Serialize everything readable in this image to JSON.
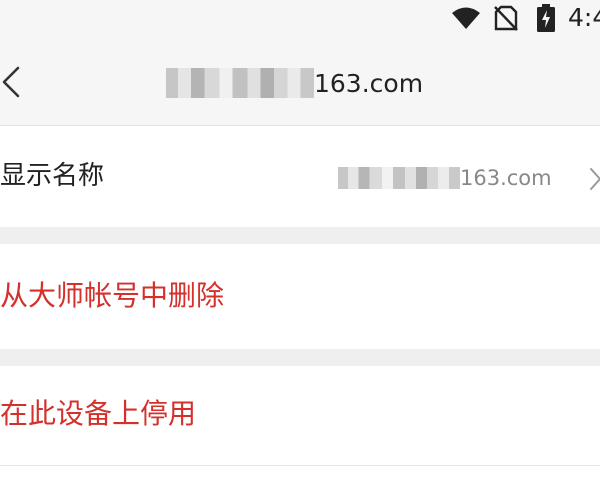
{
  "status_bar": {
    "time": "4:4",
    "icons": [
      "wifi-icon",
      "no-sim-icon",
      "battery-charging-icon"
    ]
  },
  "header": {
    "back_icon": "chevron-left-icon",
    "account_suffix": "163.com",
    "account_prefix_obscured": true
  },
  "display_name_row": {
    "label": "显示名称",
    "value_suffix": "163.com",
    "value_prefix_obscured": true,
    "chevron_icon": "chevron-right-icon"
  },
  "actions": {
    "remove_from_master": "从大师帐号中删除",
    "disable_on_device": "在此设备上停用"
  },
  "colors": {
    "header_bg": "#f6f6f6",
    "divider_gap": "#efefef",
    "danger_text": "#d4302c",
    "primary_text": "#222222",
    "secondary_text": "#888888"
  }
}
